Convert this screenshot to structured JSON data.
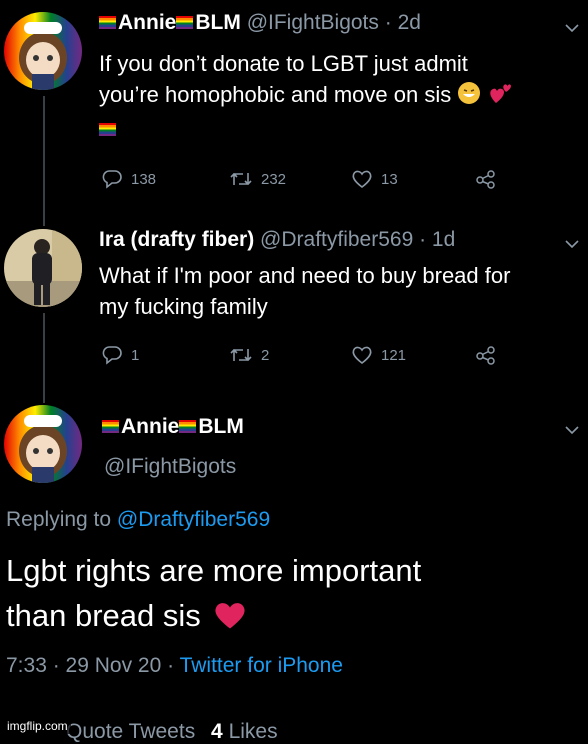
{
  "tweet1": {
    "display_name_parts": [
      "Annie",
      "BLM"
    ],
    "handle": "@IFightBigots",
    "time": "· 2d",
    "text_line1": "If you don’t donate to LGBT just admit",
    "text_line2": "you’re homophobic and move on sis",
    "reply_count": "138",
    "retweet_count": "232",
    "like_count": "13"
  },
  "tweet2": {
    "display_name": "Ira (drafty fiber)",
    "handle": "@Draftyfiber569",
    "time": "· 1d",
    "text_line1": "What if I'm poor and need to buy bread for",
    "text_line2": "my fucking family",
    "reply_count": "1",
    "retweet_count": "2",
    "like_count": "121"
  },
  "tweet3": {
    "display_name_parts": [
      "Annie",
      "BLM"
    ],
    "handle": "@IFightBigots",
    "replying_label": "Replying to",
    "replying_handle": "@Draftyfiber569",
    "text_line1": "Lgbt rights are more important",
    "text_line2": "than bread sis",
    "timestamp": "7:33 · 29 Nov 20 ·",
    "source": "Twitter for iPhone"
  },
  "footer": {
    "quote_tweets_label": "Quote Tweets",
    "likes_count": "4",
    "likes_label": "Likes"
  },
  "watermark": "imgflip.com",
  "colors": {
    "muted": "#8b98a5",
    "link": "#1d9bf0",
    "heart": "#e0245e"
  }
}
